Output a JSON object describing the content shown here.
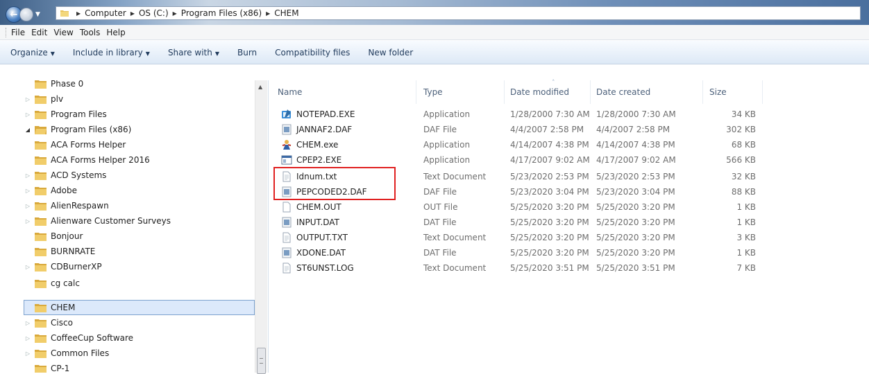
{
  "address_bar": {
    "crumbs": [
      "Computer",
      "OS (C:)",
      "Program Files (x86)",
      "CHEM"
    ]
  },
  "menu": {
    "items": [
      "File",
      "Edit",
      "View",
      "Tools",
      "Help"
    ]
  },
  "toolbar": {
    "organize": "Organize",
    "include_in_library": "Include in library",
    "share_with": "Share with",
    "burn": "Burn",
    "compatibility_files": "Compatibility files",
    "new_folder": "New folder"
  },
  "tree": {
    "items": [
      {
        "label": "Phase 0"
      },
      {
        "label": "plv"
      },
      {
        "label": "Program Files"
      },
      {
        "label": "Program Files (x86)"
      },
      {
        "label": "ACA Forms Helper"
      },
      {
        "label": "ACA Forms Helper 2016"
      },
      {
        "label": "ACD Systems"
      },
      {
        "label": "Adobe"
      },
      {
        "label": "AlienRespawn"
      },
      {
        "label": "Alienware Customer Surveys"
      },
      {
        "label": "Bonjour"
      },
      {
        "label": "BURNRATE"
      },
      {
        "label": "CDBurnerXP"
      },
      {
        "label": "cg calc"
      },
      {
        "label": "CHEM"
      },
      {
        "label": "Cisco"
      },
      {
        "label": "CoffeeCup Software"
      },
      {
        "label": "Common Files"
      },
      {
        "label": "CP-1"
      }
    ],
    "selected": "CHEM"
  },
  "file_list": {
    "columns": [
      "Name",
      "Type",
      "Date modified",
      "Date created",
      "Size"
    ],
    "rows": [
      {
        "name": "NOTEPAD.EXE",
        "type": "Application",
        "modified": "1/28/2000 7:30 AM",
        "created": "1/28/2000 7:30 AM",
        "size": "34 KB",
        "icon": "notepad-icon"
      },
      {
        "name": "JANNAF2.DAF",
        "type": "DAF File",
        "modified": "4/4/2007 2:58 PM",
        "created": "4/4/2007 2:58 PM",
        "size": "302 KB",
        "icon": "data-file-icon"
      },
      {
        "name": "CHEM.exe",
        "type": "Application",
        "modified": "4/14/2007 4:38 PM",
        "created": "4/14/2007 4:38 PM",
        "size": "68 KB",
        "icon": "chem-app-icon"
      },
      {
        "name": "CPEP2.EXE",
        "type": "Application",
        "modified": "4/17/2007 9:02 AM",
        "created": "4/17/2007 9:02 AM",
        "size": "566 KB",
        "icon": "window-app-icon"
      },
      {
        "name": "Idnum.txt",
        "type": "Text Document",
        "modified": "5/23/2020 2:53 PM",
        "created": "5/23/2020 2:53 PM",
        "size": "32 KB",
        "icon": "text-file-icon"
      },
      {
        "name": "PEPCODED2.DAF",
        "type": "DAF File",
        "modified": "5/23/2020 3:04 PM",
        "created": "5/23/2020 3:04 PM",
        "size": "88 KB",
        "icon": "data-file-icon"
      },
      {
        "name": "CHEM.OUT",
        "type": "OUT File",
        "modified": "5/25/2020 3:20 PM",
        "created": "5/25/2020 3:20 PM",
        "size": "1 KB",
        "icon": "blank-file-icon"
      },
      {
        "name": "INPUT.DAT",
        "type": "DAT File",
        "modified": "5/25/2020 3:20 PM",
        "created": "5/25/2020 3:20 PM",
        "size": "1 KB",
        "icon": "data-file-icon"
      },
      {
        "name": "OUTPUT.TXT",
        "type": "Text Document",
        "modified": "5/25/2020 3:20 PM",
        "created": "5/25/2020 3:20 PM",
        "size": "3 KB",
        "icon": "text-file-icon"
      },
      {
        "name": "XDONE.DAT",
        "type": "DAT File",
        "modified": "5/25/2020 3:20 PM",
        "created": "5/25/2020 3:20 PM",
        "size": "1 KB",
        "icon": "data-file-icon"
      },
      {
        "name": "ST6UNST.LOG",
        "type": "Text Document",
        "modified": "5/25/2020 3:51 PM",
        "created": "5/25/2020 3:51 PM",
        "size": "7 KB",
        "icon": "text-file-icon"
      }
    ]
  },
  "colors": {
    "selection_fill": "#dce9fb",
    "selection_border": "#7da2ce",
    "highlight_box": "#e02020",
    "folder": "#e8c25a"
  }
}
